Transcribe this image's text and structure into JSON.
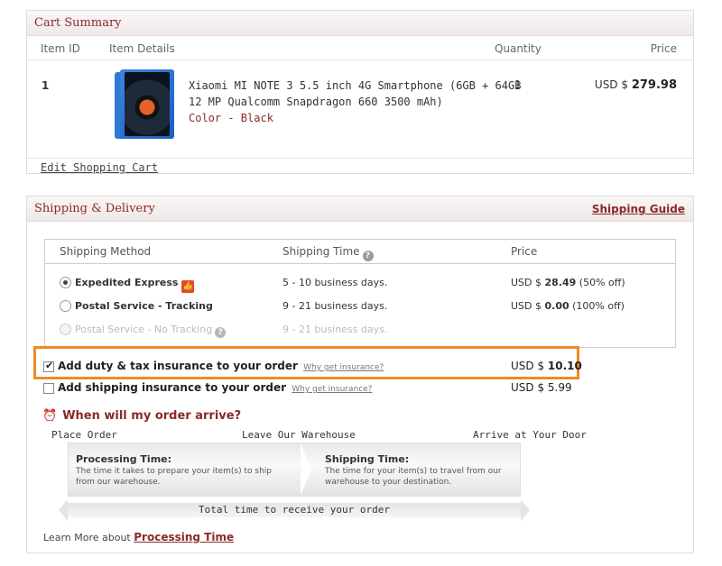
{
  "cart": {
    "title": "Cart Summary",
    "columns": {
      "item_id": "Item ID",
      "item_details": "Item Details",
      "quantity": "Quantity",
      "price": "Price"
    },
    "item": {
      "id": "1",
      "line1": "Xiaomi MI NOTE 3 5.5 inch 4G Smartphone (6GB + 64GB",
      "line2": "12 MP Qualcomm Snapdragon 660 3500 mAh)",
      "color": "Color - Black",
      "quantity": "1",
      "currency": "USD $",
      "price": "279.98"
    },
    "edit_link": "Edit Shopping Cart"
  },
  "shipping": {
    "title": "Shipping & Delivery",
    "guide": "Shipping Guide",
    "columns": {
      "method": "Shipping Method",
      "time": "Shipping Time",
      "price": "Price"
    },
    "methods": [
      {
        "name": "Expedited Express",
        "time": "5 - 10 business days.",
        "currency": "USD $",
        "price": "28.49",
        "note": "(50% off)"
      },
      {
        "name": "Postal Service - Tracking",
        "time": "9 - 21 business days.",
        "currency": "USD $",
        "price": "0.00",
        "note": "(100% off)"
      },
      {
        "name": "Postal Service - No Tracking",
        "time": "9 - 21 business days."
      }
    ],
    "insurance": [
      {
        "label": "Add duty & tax insurance to your order",
        "why": "Why get insurance?",
        "currency": "USD $",
        "price": "10.10",
        "checked": true
      },
      {
        "label": "Add shipping insurance to your order",
        "why": "Why get insurance?",
        "price_text": "USD $ 5.99",
        "checked": false
      }
    ],
    "arrive": {
      "title": "When will my order arrive?",
      "step1": "Place Order",
      "step2": "Leave Our Warehouse",
      "step3": "Arrive at Your Door",
      "processing_title": "Processing Time:",
      "processing_line1": "The time it takes to prepare your item(s) to ship",
      "processing_line2": "from our warehouse.",
      "shipping_title": "Shipping Time:",
      "shipping_line1": "The time  for your item(s) to travel from our",
      "shipping_line2": "warehouse to your destination.",
      "total": "Total time to receive your order"
    },
    "learn_prefix": "Learn More about",
    "learn_link": "Processing Time"
  },
  "icons": {
    "question": "?",
    "thumb": "👍",
    "alarm": "⏰"
  },
  "colors": {
    "accent": "#8a2a2a",
    "highlight": "#f08a24"
  }
}
